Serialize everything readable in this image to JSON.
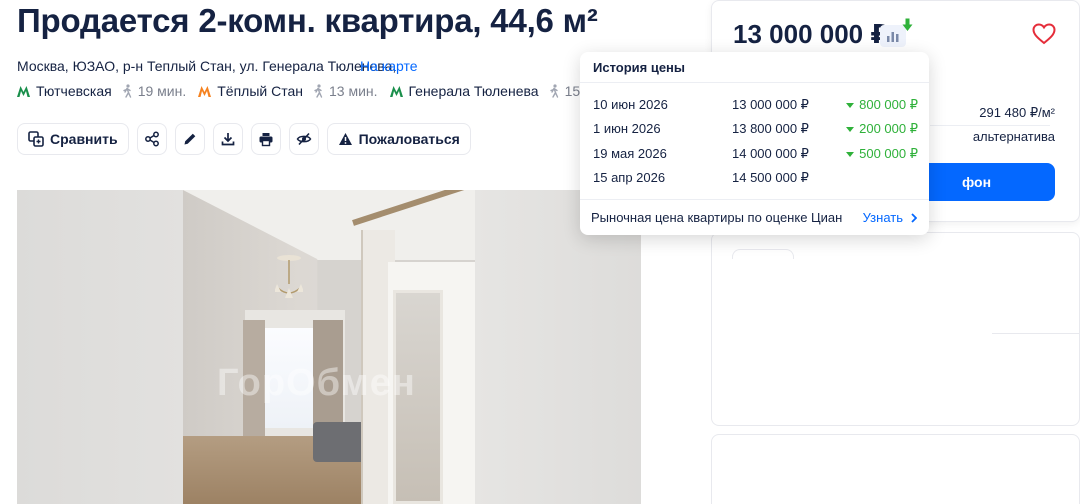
{
  "title": "Продается 2-комн. квартира, 44,6 м²",
  "address": {
    "text": "Москва, ЮЗАО, р-н Теплый Стан, ул. Генерала Тюленева,",
    "map_link": "На карте"
  },
  "metro": [
    {
      "name": "Тютчевская",
      "walk": "19 мин.",
      "color": "#1a8f4b"
    },
    {
      "name": "Тёплый Стан",
      "walk": "13 мин.",
      "color": "#f58220"
    },
    {
      "name": "Генерала Тюленева",
      "walk": "15 мин.",
      "color": "#1a8f4b"
    }
  ],
  "actions": {
    "compare_label": "Сравнить",
    "complain_label": "Пожаловаться",
    "icons": [
      "share-icon",
      "edit-icon",
      "download-icon",
      "print-icon",
      "hide-icon"
    ]
  },
  "gallery": {
    "watermark": "ГорОбмен"
  },
  "price_card": {
    "price": "13 000 000 ₽",
    "price_per_sqm": "291 480 ₽/м²",
    "deal_type": "альтернатива",
    "phone_button": "фон"
  },
  "price_history": {
    "title": "История цены",
    "rows": [
      {
        "date": "10 июн 2026",
        "price": "13 000 000 ₽",
        "change": "800 000 ₽"
      },
      {
        "date": "1 июн 2026",
        "price": "13 800 000 ₽",
        "change": "200 000 ₽"
      },
      {
        "date": "19 мая 2026",
        "price": "14 000 000 ₽",
        "change": "500 000 ₽"
      },
      {
        "date": "15 апр 2026",
        "price": "14 500 000 ₽",
        "change": ""
      }
    ],
    "market_text": "Рыночная цена квартиры по оценке Циан",
    "learn_more": "Узнать"
  },
  "colors": {
    "accent": "#0468ff",
    "text": "#152242",
    "muted": "#7a7f8c",
    "decrease": "#2fb13a",
    "favorite": "#e52d3a"
  }
}
